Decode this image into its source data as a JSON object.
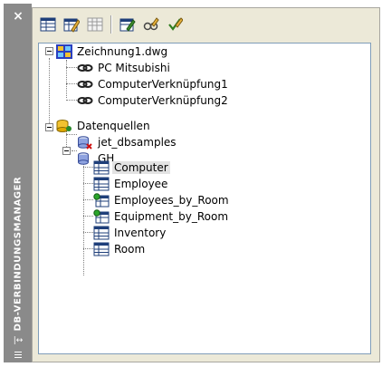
{
  "palette": {
    "vertical_title": "DB-VERBINDUNGSMANAGER",
    "close_glyph": "×"
  },
  "toolbar": {
    "buttons": [
      {
        "name": "view-table-button",
        "icon": "table-icon"
      },
      {
        "name": "edit-table-button",
        "icon": "edit-table-icon"
      },
      {
        "name": "new-table-button",
        "icon": "grid-icon"
      },
      {
        "name": "new-link-template-button",
        "icon": "link-template-icon"
      },
      {
        "name": "new-label-template-button",
        "icon": "label-template-icon"
      },
      {
        "name": "link-select-button",
        "icon": "link-select-icon"
      }
    ]
  },
  "tree": {
    "drawing": "Zeichnung1.dwg",
    "drawing_children": [
      "PC Mitsubishi",
      "ComputerVerknüpfung1",
      "ComputerVerknüpfung2"
    ],
    "datasources_label": "Datenquellen",
    "datasources": [
      {
        "label": "jet_dbsamples",
        "state": "disconnected"
      },
      {
        "label": "GH",
        "state": "connected"
      }
    ],
    "gh_tables": [
      {
        "label": "Computer",
        "type": "table",
        "selected": true
      },
      {
        "label": "Employee",
        "type": "table",
        "selected": false
      },
      {
        "label": "Employees_by_Room",
        "type": "view",
        "selected": false
      },
      {
        "label": "Equipment_by_Room",
        "type": "view",
        "selected": false
      },
      {
        "label": "Inventory",
        "type": "table",
        "selected": false
      },
      {
        "label": "Room",
        "type": "table",
        "selected": false
      }
    ]
  },
  "colors": {
    "titlebar": "#8a8a8a",
    "frame": "#ece9d8",
    "selection": "#e3e3e3",
    "tree_border": "#7f9db9"
  }
}
